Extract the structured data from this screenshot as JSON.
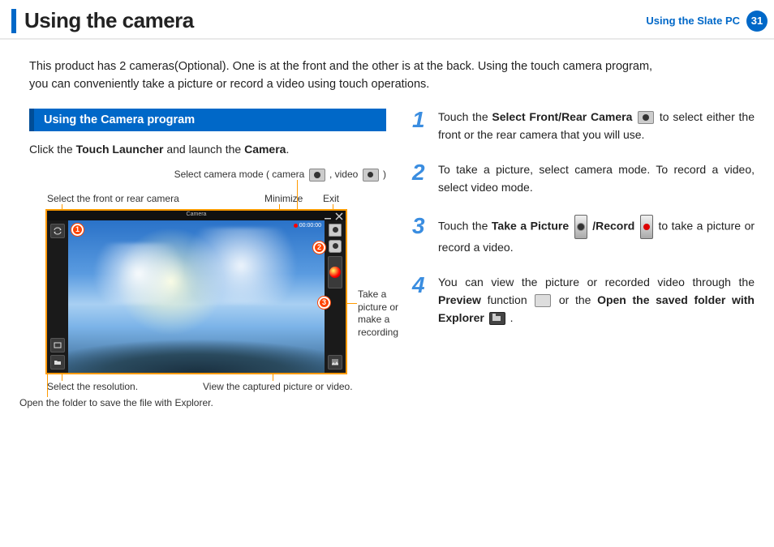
{
  "header": {
    "title": "Using the camera",
    "section": "Using the Slate PC",
    "page": "31"
  },
  "intro": "This product has 2 cameras(Optional). One is at the front and the other is at the back. Using the touch camera program,\nyou can conveniently take a picture or record a video using touch operations.",
  "left": {
    "heading": "Using the Camera program",
    "click_the": "Click the ",
    "touch_launcher": "Touch Launcher",
    "and_launch_the": " and launch the ",
    "camera": "Camera",
    "period": "."
  },
  "callouts": {
    "select_mode_pre": "Select camera mode ( camera ",
    "select_mode_mid": " , video ",
    "select_mode_post": " )",
    "select_front": "Select the front or rear camera",
    "minimize": "Minimize",
    "exit": "Exit",
    "take_picture": "Take a picture or make a recording",
    "select_resolution": "Select the resolution.",
    "view_captured": "View the captured picture or video.",
    "open_folder": "Open the folder to save the file with Explorer."
  },
  "shot_title": "Camera",
  "markers": {
    "m1": "1",
    "m2": "2",
    "m3": "3"
  },
  "steps": {
    "s1": {
      "num": "1",
      "pre": "Touch the ",
      "bold1": "Select Front/Rear Camera",
      "post": " to select either the front or the rear camera that you will use."
    },
    "s2": {
      "num": "2",
      "text": "To take a picture, select camera mode. To record a video, select video mode."
    },
    "s3": {
      "num": "3",
      "pre": "Touch the ",
      "bold1": "Take a Picture",
      "mid": " /",
      "bold2": "Record",
      "post": " to take a picture or record a video."
    },
    "s4": {
      "num": "4",
      "pre": "You can view the picture or recorded video through the ",
      "bold1": "Preview",
      "mid1": " function ",
      "mid2": " or the ",
      "bold2": "Open the saved folder with Explorer",
      "post": " ."
    }
  }
}
